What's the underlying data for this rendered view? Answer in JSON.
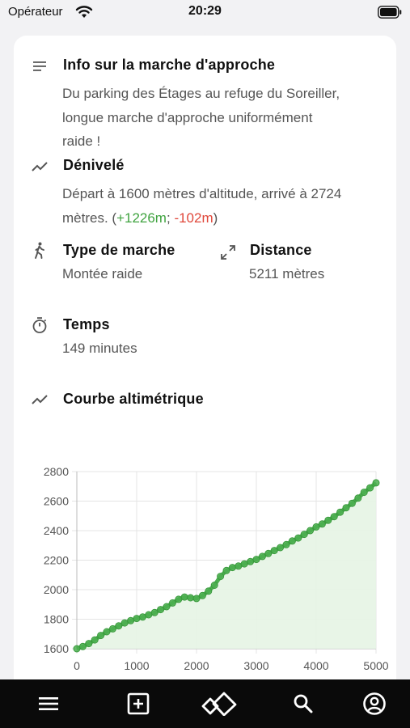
{
  "status_bar": {
    "carrier": "Opérateur",
    "time": "20:29"
  },
  "approach": {
    "title": "Info sur la marche d'approche",
    "text_lines": [
      "Du parking des Étages au refuge du Soreiller,",
      "longue marche d'approche uniformément",
      "raide !"
    ]
  },
  "elevation": {
    "title": "Dénivelé",
    "line1": "Départ à 1600 mètres d'altitude, arrivé à 2724",
    "line2_prefix": "mètres. (",
    "gain": "+1226m",
    "separator": "; ",
    "loss": "-102m",
    "line2_suffix": ")"
  },
  "walk_type": {
    "title": "Type de marche",
    "value": "Montée raide"
  },
  "distance": {
    "title": "Distance",
    "value": "5211 mètres"
  },
  "time_info": {
    "title": "Temps",
    "value": "149 minutes"
  },
  "profile": {
    "title": "Courbe altimétrique"
  },
  "colors": {
    "gain": "#3fa33f",
    "loss": "#e0473a",
    "series": "#4caf50",
    "fill": "#e6f4e4",
    "nav_bg": "#0a0a0a"
  },
  "icons": {
    "approach": "notes-icon",
    "elevation": "trend-icon",
    "walk_type": "hiker-icon",
    "distance": "expand-arrows-icon",
    "time": "stopwatch-icon",
    "profile": "trend-icon"
  },
  "chart_data": {
    "type": "area",
    "xlim": [
      0,
      5000
    ],
    "ylim": [
      1600,
      2800
    ],
    "x_ticks": [
      "0",
      "1000",
      "2000",
      "3000",
      "4000",
      "5000"
    ],
    "y_ticks": [
      "1600",
      "1800",
      "2000",
      "2200",
      "2400",
      "2600",
      "2800"
    ],
    "grid": true,
    "legend": "none",
    "series": [
      {
        "x": [
          0,
          100,
          200,
          300,
          400,
          500,
          600,
          700,
          800,
          900,
          1000,
          1100,
          1200,
          1300,
          1400,
          1500,
          1600,
          1700,
          1800,
          1900,
          2000,
          2100,
          2200,
          2300,
          2400,
          2500,
          2600,
          2700,
          2800,
          2900,
          3000,
          3100,
          3200,
          3300,
          3400,
          3500,
          3600,
          3700,
          3800,
          3900,
          4000,
          4100,
          4200,
          4300,
          4400,
          4500,
          4600,
          4700,
          4800,
          4900,
          5000
        ],
        "y": [
          1600,
          1615,
          1635,
          1660,
          1690,
          1715,
          1735,
          1755,
          1775,
          1790,
          1805,
          1815,
          1830,
          1845,
          1865,
          1885,
          1910,
          1935,
          1950,
          1945,
          1940,
          1960,
          1990,
          2030,
          2090,
          2130,
          2150,
          2160,
          2175,
          2190,
          2205,
          2225,
          2245,
          2265,
          2285,
          2305,
          2330,
          2350,
          2375,
          2400,
          2425,
          2445,
          2470,
          2495,
          2525,
          2555,
          2585,
          2620,
          2660,
          2690,
          2724
        ]
      }
    ]
  }
}
